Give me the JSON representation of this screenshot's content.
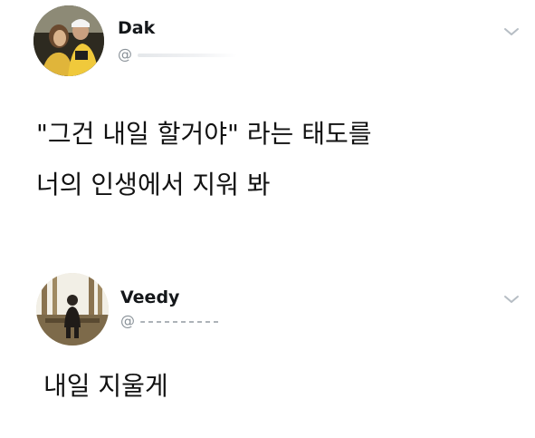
{
  "tweets": [
    {
      "name": "Dak",
      "handle": "@",
      "lines": [
        "\"그건 내일 할거야\" 라는 태도를",
        "너의 인생에서 지워 봐"
      ],
      "menu_icon": "chevron-down-icon"
    },
    {
      "name": "Veedy",
      "handle": "@",
      "lines": [
        "내일 지울게"
      ],
      "menu_icon": "chevron-down-icon"
    }
  ],
  "colors": {
    "name": "#14171a",
    "handle": "#8a9299",
    "body": "#111111",
    "chevron": "#b6bdc4"
  }
}
